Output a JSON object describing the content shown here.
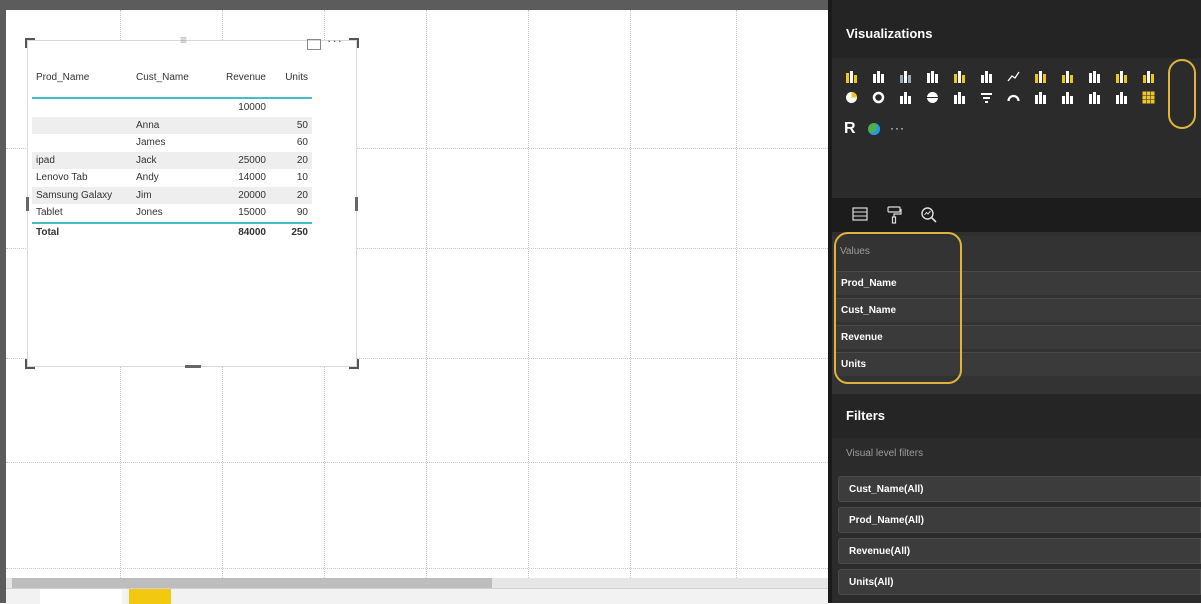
{
  "table_visual": {
    "headers": [
      "Prod_Name",
      "Cust_Name",
      "Revenue",
      "Units"
    ],
    "rows": [
      [
        "",
        "",
        "10000",
        ""
      ],
      [
        "",
        "Anna",
        "",
        "50"
      ],
      [
        "",
        "James",
        "",
        "60"
      ],
      [
        "ipad",
        "Jack",
        "25000",
        "20"
      ],
      [
        "Lenovo Tab",
        "Andy",
        "14000",
        "10"
      ],
      [
        "Samsung Galaxy",
        "Jim",
        "20000",
        "20"
      ],
      [
        "Tablet",
        "Jones",
        "15000",
        "90"
      ]
    ],
    "total": [
      "Total",
      "",
      "84000",
      "250"
    ],
    "more_label": "···",
    "grip_label": "≡"
  },
  "visualizations": {
    "title": "Visualizations",
    "r_label": "R",
    "more_label": "···"
  },
  "values": {
    "label": "Values",
    "fields": [
      "Prod_Name",
      "Cust_Name",
      "Revenue",
      "Units"
    ]
  },
  "filters": {
    "title": "Filters",
    "sublabel": "Visual level filters",
    "items": [
      "Cust_Name(All)",
      "Prod_Name(All)",
      "Revenue(All)",
      "Units(All)"
    ]
  },
  "colors": {
    "accent": "#45bdc4",
    "highlight": "#e0b43c",
    "page_tab_add": "#f2c811"
  }
}
